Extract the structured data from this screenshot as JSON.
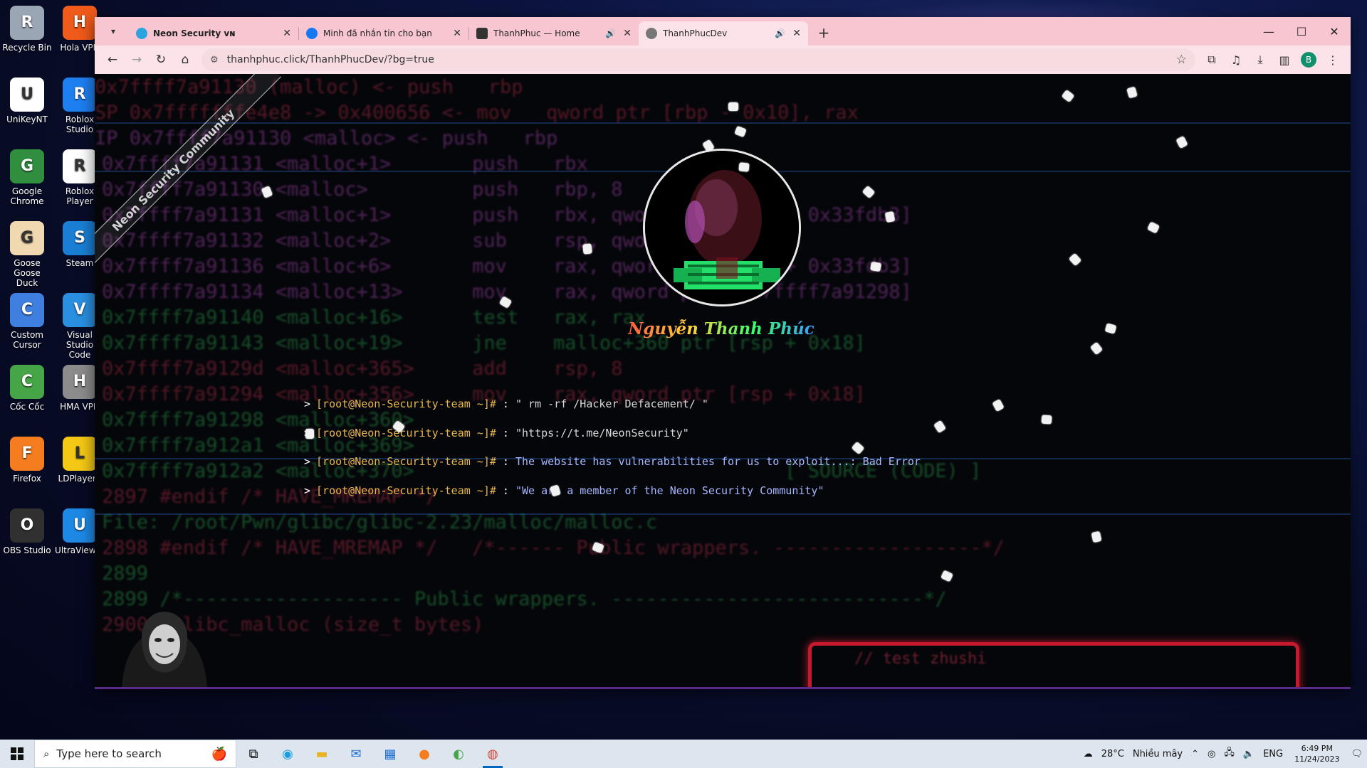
{
  "desktop": {
    "icons": [
      {
        "label": "Recycle Bin",
        "icon": "recycle-bin-icon",
        "color": "#9aa6b3"
      },
      {
        "label": "Hola VPN",
        "icon": "hola-vpn-icon",
        "color": "#f05a1a"
      },
      {
        "label": "UniKeyNT",
        "icon": "unikey-icon",
        "color": "#ffffff"
      },
      {
        "label": "Roblox Studio",
        "icon": "roblox-studio-icon",
        "color": "#1e7ff0"
      },
      {
        "label": "Google Chrome",
        "icon": "chrome-icon",
        "color": "#2f8f3e"
      },
      {
        "label": "Roblox Player",
        "icon": "roblox-player-icon",
        "color": "#ffffff"
      },
      {
        "label": "Goose Goose Duck",
        "icon": "goose-goose-duck-icon",
        "color": "#f0d8b0"
      },
      {
        "label": "Steam",
        "icon": "steam-icon",
        "color": "#1a7fd4"
      },
      {
        "label": "Custom Cursor",
        "icon": "custom-cursor-icon",
        "color": "#3f7fe0"
      },
      {
        "label": "Visual Studio Code",
        "icon": "vscode-icon",
        "color": "#2a8fe0"
      },
      {
        "label": "Cốc Cốc",
        "icon": "coc-coc-icon",
        "color": "#46a546"
      },
      {
        "label": "HMA VPN",
        "icon": "hma-vpn-icon",
        "color": "#8c8c8c"
      },
      {
        "label": "Firefox",
        "icon": "firefox-icon",
        "color": "#f57c1f"
      },
      {
        "label": "LDPlayer5",
        "icon": "ldplayer-icon",
        "color": "#f4c814"
      },
      {
        "label": "OBS Studio",
        "icon": "obs-studio-icon",
        "color": "#303030"
      },
      {
        "label": "UltraViewer",
        "icon": "ultraviewer-icon",
        "color": "#1e88e5"
      }
    ]
  },
  "browser": {
    "tabs": [
      {
        "title": "Neon Security ᴠɴ",
        "icon": "telegram-icon",
        "icon_color": "#2aa3df",
        "audio": false,
        "active": false
      },
      {
        "title": "Minh đã nhắn tin cho bạn",
        "icon": "facebook-icon",
        "icon_color": "#1877f2",
        "audio": false,
        "active": false
      },
      {
        "title": "ThanhPhuc — Home",
        "icon": "site-icon",
        "icon_color": "#333333",
        "audio": true,
        "active": false
      },
      {
        "title": "ThanhPhucDev",
        "icon": "globe-icon",
        "icon_color": "#666666",
        "audio": true,
        "active": true
      }
    ],
    "url": "thanhphuc.click/ThanhPhucDev/?bg=true",
    "profile_initial": "B",
    "accent": "#f8c6d1"
  },
  "page": {
    "ribbon_text": "Neon Security Community",
    "name": "Nguyễn Thanh Phúc",
    "terminal": [
      {
        "prompt": "[root@Neon-Security-team ~]#",
        "command": "\" rm -rf /Hacker Defacement/ \"",
        "style": "white"
      },
      {
        "prompt": "[root@Neon-Security-team ~]#",
        "command": "\"https://t.me/NeonSecurity\"",
        "style": "white"
      },
      {
        "prompt": "[root@Neon-Security-team ~]#",
        "command": "The website has vulnerabilities for us to exploit...: Bad Error",
        "style": "blue"
      },
      {
        "prompt": "[root@Neon-Security-team ~]#",
        "command": "\"We are a member of the Neon Security Community\"",
        "style": "white"
      }
    ],
    "background_code": [
      "0x7ffff7a91130 (malloc) <- push   rbp",
      "SP 0x7fffffffe4e8 -> 0x400656 <- mov   qword ptr [rbp - 0x10], rax",
      "IP 0x7ffff7a91130 <malloc> <- push   rbp",
      "0x7ffff7a91131 <malloc+1>       push   rbx",
      "0x7ffff7a91130 <malloc>         push   rbp, 8",
      "0x7ffff7a91131 <malloc+1>       push   rbx, qword ptr [rip + 0x33fdb3]",
      "0x7ffff7a91132 <malloc+2>       sub    rsp, qword ptr",
      "0x7ffff7a91136 <malloc+6>       mov    rax, qword ptr [rip + 0x33fdb3]",
      "0x7ffff7a91134 <malloc+13>      mov    rax, qword ptr [0x7ffff7a91298]",
      "0x7ffff7a91140 <malloc+16>      test   rax, rax",
      "0x7ffff7a91143 <malloc+19>      jne    malloc+360 ptr [rsp + 0x18]",
      "0x7ffff7a9129d <malloc+365>     add    rsp, 8",
      "0x7ffff7a91294 <malloc+356>     mov    rax, qword ptr [rsp + 0x18]",
      "0x7ffff7a91298 <malloc+360>",
      "0x7ffff7a912a1 <malloc+369>",
      "0x7ffff7a912a2 <malloc+370>                                [ SOURCE (CODE) ]",
      "2897 #endif /* HAVE_MREMAP */",
      "File: /root/Pwn/glibc/glibc-2.23/malloc/malloc.c",
      "2898 #endif /* HAVE_MREMAP */   /*------ Public wrappers. ------------------*/",
      "2899",
      "2899 /*------------------- Public wrappers. ---------------------------*/",
      "2900 __libc_malloc (size_t bytes)"
    ],
    "red_box_text": "// test zhushi"
  },
  "taskbar": {
    "search_placeholder": "Type here to search",
    "weather_temp": "28°C",
    "weather_desc": "Nhiều mây",
    "language": "ENG",
    "time": "6:49 PM",
    "date": "11/24/2023"
  }
}
